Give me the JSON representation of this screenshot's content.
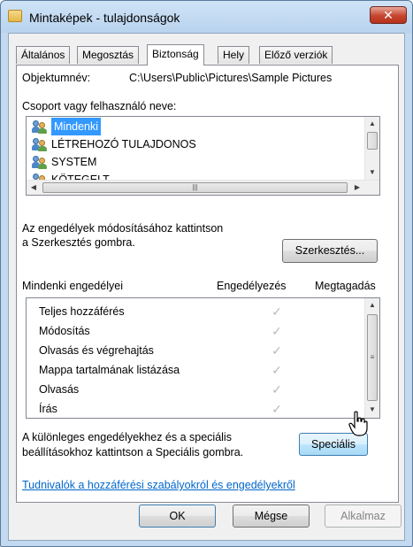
{
  "window": {
    "title": "Mintaképek - tulajdonságok",
    "close_glyph": "✕"
  },
  "tabs": [
    {
      "label": "Általános",
      "active": false
    },
    {
      "label": "Megosztás",
      "active": false
    },
    {
      "label": "Biztonság",
      "active": true
    },
    {
      "label": "Hely",
      "active": false
    },
    {
      "label": "Előző verziók",
      "active": false
    }
  ],
  "object": {
    "label": "Objektumnév:",
    "value": "C:\\Users\\Public\\Pictures\\Sample Pictures"
  },
  "groups": {
    "label": "Csoport vagy felhasználó neve:",
    "items": [
      {
        "name": "Mindenki",
        "selected": true
      },
      {
        "name": "LÉTREHOZÓ TULAJDONOS",
        "selected": false
      },
      {
        "name": "SYSTEM",
        "selected": false
      },
      {
        "name": "KÖTEGELT",
        "selected": false
      }
    ]
  },
  "edit": {
    "hint_line1": "Az engedélyek módosításához kattintson",
    "hint_line2": "a Szerkesztés gombra.",
    "button": "Szerkesztés..."
  },
  "permissions": {
    "header_label": "Mindenki engedélyei",
    "col_allow": "Engedélyezés",
    "col_deny": "Megtagadás",
    "rows": [
      {
        "name": "Teljes hozzáférés",
        "allow": true,
        "deny": false
      },
      {
        "name": "Módosítás",
        "allow": true,
        "deny": false
      },
      {
        "name": "Olvasás és végrehajtás",
        "allow": true,
        "deny": false
      },
      {
        "name": "Mappa tartalmának listázása",
        "allow": true,
        "deny": false
      },
      {
        "name": "Olvasás",
        "allow": true,
        "deny": false
      },
      {
        "name": "Írás",
        "allow": true,
        "deny": false
      }
    ]
  },
  "special": {
    "hint_line1": "A különleges engedélyekhez és a speciális",
    "hint_line2": "beállításokhoz kattintson a Speciális gombra.",
    "button": "Speciális"
  },
  "info_link": "Tudnivalók a hozzáférési szabályokról és engedélyekről",
  "footer": {
    "ok": "OK",
    "cancel": "Mégse",
    "apply": "Alkalmaz"
  },
  "colors": {
    "selection": "#3399ff",
    "link": "#0066cc",
    "checkmark": "#b8b8b8"
  }
}
